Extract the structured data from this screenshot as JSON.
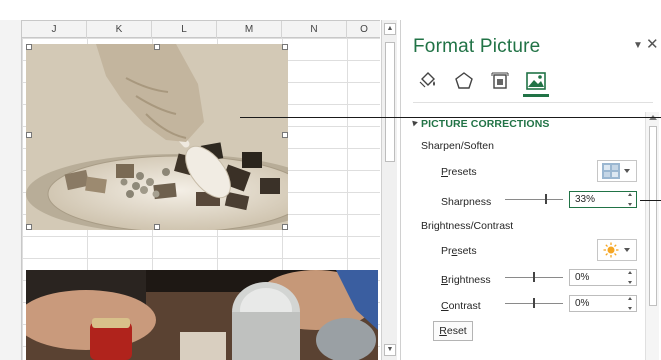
{
  "columns": [
    "J",
    "K",
    "L",
    "M",
    "N",
    "O"
  ],
  "panel": {
    "title": "Format Picture",
    "dropdown_icon": "chevron-down-icon",
    "close_icon": "close-icon",
    "tabs": [
      {
        "name": "fill-line-icon"
      },
      {
        "name": "effects-icon"
      },
      {
        "name": "size-properties-icon"
      },
      {
        "name": "picture-icon",
        "active": true
      }
    ],
    "section_header": "PICTURE CORRECTIONS",
    "sharpen": {
      "heading": "Sharpen/Soften",
      "presets_label_pre": "",
      "presets_label_ul": "P",
      "presets_label_post": "resets",
      "sharpness_label": "Sharpness",
      "sharpness_value": "33%",
      "sharpness_level": 0.33
    },
    "brightness": {
      "heading": "Brightness/Contrast",
      "presets_label_pre": "Pr",
      "presets_label_ul": "e",
      "presets_label_post": "sets",
      "brightness_label_ul": "B",
      "brightness_label_post": "rightness",
      "brightness_value": "0%",
      "brightness_level": 0.5,
      "contrast_label_ul": "C",
      "contrast_label_post": "ontrast",
      "contrast_value": "0%",
      "contrast_level": 0.5
    },
    "reset_label_ul": "R",
    "reset_label_post": "eset"
  },
  "colors": {
    "accent": "#217346"
  }
}
